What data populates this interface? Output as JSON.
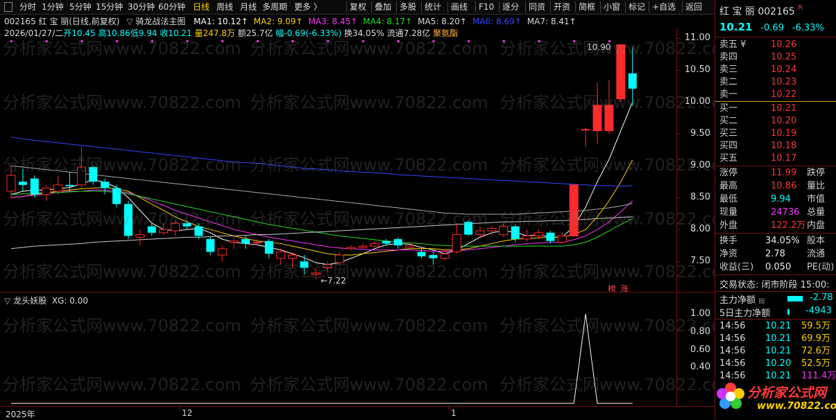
{
  "toolbar": {
    "left_items": [
      "分时",
      "1分钟",
      "5分钟",
      "15分钟",
      "30分钟",
      "60分钟",
      "日线",
      "周线",
      "月线",
      "多周期",
      "更多 〉"
    ],
    "active_item": "日线",
    "right_items": [
      "复权",
      "叠加",
      "多股",
      "统计",
      "画线",
      "F10",
      "逐分",
      "同资",
      "开资",
      "简框",
      "小窗",
      "标记",
      "+自选",
      "返回"
    ]
  },
  "chart_header": {
    "title": "002165 红 宝 丽(日线,前复权)",
    "indicator_name": "骑龙战法主图",
    "ma": [
      {
        "label": "MA1: 10.12↑",
        "color": "#ffffff"
      },
      {
        "label": "MA2: 9.09↑",
        "color": "#ffd200"
      },
      {
        "label": "MA3: 8.45↑",
        "color": "#ff33ff"
      },
      {
        "label": "MA4: 8.17↑",
        "color": "#22dd22"
      },
      {
        "label": "MA5: 8.20↑",
        "color": "#dddddd"
      },
      {
        "label": "MA6: 8.69↑",
        "color": "#3344ff"
      },
      {
        "label": "MA7: 8.41↑",
        "color": "#dddddd"
      }
    ],
    "info_line": {
      "date": "2026/01/27/二",
      "open": "开10.45",
      "high": "高10.86",
      "low": "低9.94",
      "close": "收10.21",
      "volume": "量247.8万",
      "amount": "额25.7亿",
      "change": "幅-0.69(-6.33%)",
      "turnover": "换34.05%",
      "float": "流通7.28亿",
      "concept": "聚氨酯"
    }
  },
  "main_axis": {
    "labels": [
      "11.00",
      "10.50",
      "10.00",
      "9.50",
      "9.00",
      "8.50",
      "8.00",
      "7.50"
    ]
  },
  "annotations": {
    "high": "10.90",
    "low": "←7.22",
    "badge1": "榜",
    "badge2": "涨"
  },
  "sub_chart": {
    "title": "龙头妖股",
    "xg": "XG: 0.00",
    "axis_labels": [
      "1.00",
      "0.80",
      "0.60",
      "0.40"
    ]
  },
  "x_axis": {
    "labels": [
      "2025年",
      "12",
      "1"
    ]
  },
  "watermark": "分析家公式网www.70822.com",
  "colors": {
    "up": "#ff2a2a",
    "down": "#00ffff",
    "bg": "#000000",
    "grid_red": "#7a1010"
  },
  "chart_data": {
    "type": "candlestick",
    "ylim": [
      7.1,
      11.1
    ],
    "candles": [
      {
        "o": 8.6,
        "c": 8.85,
        "h": 9.0,
        "l": 8.5
      },
      {
        "o": 8.75,
        "c": 8.7,
        "h": 8.95,
        "l": 8.6
      },
      {
        "o": 8.8,
        "c": 8.55,
        "h": 8.85,
        "l": 8.5
      },
      {
        "o": 8.55,
        "c": 8.65,
        "h": 8.7,
        "l": 8.45
      },
      {
        "o": 8.6,
        "c": 8.7,
        "h": 8.85,
        "l": 8.55
      },
      {
        "o": 8.7,
        "c": 8.68,
        "h": 8.9,
        "l": 8.6
      },
      {
        "o": 8.7,
        "c": 8.98,
        "h": 9.3,
        "l": 8.65
      },
      {
        "o": 8.98,
        "c": 8.75,
        "h": 9.0,
        "l": 8.7
      },
      {
        "o": 8.75,
        "c": 8.65,
        "h": 8.8,
        "l": 8.55
      },
      {
        "o": 8.65,
        "c": 8.4,
        "h": 8.7,
        "l": 8.35
      },
      {
        "o": 8.4,
        "c": 7.9,
        "h": 8.45,
        "l": 7.85
      },
      {
        "o": 7.88,
        "c": 7.92,
        "h": 8.0,
        "l": 7.75
      },
      {
        "o": 8.05,
        "c": 7.95,
        "h": 8.1,
        "l": 7.9
      },
      {
        "o": 7.95,
        "c": 8.0,
        "h": 8.1,
        "l": 7.92
      },
      {
        "o": 7.98,
        "c": 8.1,
        "h": 8.15,
        "l": 7.9
      },
      {
        "o": 8.1,
        "c": 8.05,
        "h": 8.15,
        "l": 8.0
      },
      {
        "o": 8.05,
        "c": 7.9,
        "h": 8.1,
        "l": 7.85
      },
      {
        "o": 7.85,
        "c": 7.65,
        "h": 7.9,
        "l": 7.6
      },
      {
        "o": 7.6,
        "c": 7.7,
        "h": 7.75,
        "l": 7.5
      },
      {
        "o": 7.8,
        "c": 7.82,
        "h": 7.9,
        "l": 7.7
      },
      {
        "o": 7.85,
        "c": 7.78,
        "h": 7.9,
        "l": 7.7
      },
      {
        "o": 7.8,
        "c": 7.8,
        "h": 7.85,
        "l": 7.75
      },
      {
        "o": 7.82,
        "c": 7.62,
        "h": 7.85,
        "l": 7.55
      },
      {
        "o": 7.55,
        "c": 7.65,
        "h": 7.7,
        "l": 7.45
      },
      {
        "o": 7.55,
        "c": 7.6,
        "h": 7.65,
        "l": 7.4
      },
      {
        "o": 7.5,
        "c": 7.4,
        "h": 7.6,
        "l": 7.3
      },
      {
        "o": 7.3,
        "c": 7.32,
        "h": 7.4,
        "l": 7.22
      },
      {
        "o": 7.4,
        "c": 7.45,
        "h": 7.5,
        "l": 7.35
      },
      {
        "o": 7.48,
        "c": 7.6,
        "h": 7.65,
        "l": 7.45
      },
      {
        "o": 7.7,
        "c": 7.72,
        "h": 7.75,
        "l": 7.68
      },
      {
        "o": 7.72,
        "c": 7.74,
        "h": 7.78,
        "l": 7.7
      },
      {
        "o": 7.74,
        "c": 7.78,
        "h": 7.82,
        "l": 7.72
      },
      {
        "o": 7.82,
        "c": 7.78,
        "h": 7.85,
        "l": 7.75
      },
      {
        "o": 7.85,
        "c": 7.75,
        "h": 7.88,
        "l": 7.7
      },
      {
        "o": 7.72,
        "c": 7.75,
        "h": 7.8,
        "l": 7.68
      },
      {
        "o": 7.65,
        "c": 7.58,
        "h": 7.7,
        "l": 7.55
      },
      {
        "o": 7.6,
        "c": 7.55,
        "h": 7.65,
        "l": 7.45
      },
      {
        "o": 7.55,
        "c": 7.62,
        "h": 7.7,
        "l": 7.52
      },
      {
        "o": 7.65,
        "c": 7.92,
        "h": 8.1,
        "l": 7.62
      },
      {
        "o": 8.12,
        "c": 7.92,
        "h": 8.15,
        "l": 7.9
      },
      {
        "o": 7.92,
        "c": 7.98,
        "h": 8.05,
        "l": 7.88
      },
      {
        "o": 7.98,
        "c": 8.02,
        "h": 8.05,
        "l": 7.9
      },
      {
        "o": 7.92,
        "c": 8.05,
        "h": 8.1,
        "l": 7.88
      },
      {
        "o": 8.05,
        "c": 7.85,
        "h": 8.08,
        "l": 7.8
      },
      {
        "o": 7.85,
        "c": 7.9,
        "h": 8.0,
        "l": 7.82
      },
      {
        "o": 7.9,
        "c": 7.95,
        "h": 8.0,
        "l": 7.85
      },
      {
        "o": 7.95,
        "c": 7.82,
        "h": 7.98,
        "l": 7.78
      },
      {
        "o": 7.8,
        "c": 7.9,
        "h": 7.95,
        "l": 7.78
      },
      {
        "o": 7.9,
        "c": 8.7,
        "h": 8.7,
        "l": 7.88
      },
      {
        "o": 9.57,
        "c": 9.57,
        "h": 9.6,
        "l": 9.3
      },
      {
        "o": 9.55,
        "c": 9.95,
        "h": 10.3,
        "l": 9.35
      },
      {
        "o": 9.55,
        "c": 9.95,
        "h": 10.35,
        "l": 9.5
      },
      {
        "o": 10.05,
        "c": 10.9,
        "h": 10.9,
        "l": 10.0
      },
      {
        "o": 10.45,
        "c": 10.21,
        "h": 10.86,
        "l": 9.94
      }
    ],
    "ma_lines": [
      {
        "name": "MA1",
        "color": "#ffffff",
        "values": [
          8.55,
          8.6,
          8.62,
          8.62,
          8.64,
          8.66,
          8.72,
          8.78,
          8.74,
          8.66,
          8.5,
          8.3,
          8.1,
          8.0,
          7.98,
          8.0,
          8.02,
          7.95,
          7.85,
          7.8,
          7.78,
          7.76,
          7.72,
          7.68,
          7.62,
          7.56,
          7.48,
          7.45,
          7.48,
          7.55,
          7.62,
          7.7,
          7.76,
          7.78,
          7.77,
          7.72,
          7.68,
          7.62,
          7.68,
          7.78,
          7.88,
          7.95,
          7.98,
          7.96,
          7.9,
          7.92,
          7.88,
          7.88,
          8.05,
          8.35,
          8.75,
          9.1,
          9.55,
          10.0
        ]
      },
      {
        "name": "MA2",
        "color": "#ffd200",
        "values": [
          8.5,
          8.52,
          8.55,
          8.58,
          8.6,
          8.62,
          8.64,
          8.65,
          8.66,
          8.64,
          8.6,
          8.5,
          8.4,
          8.3,
          8.2,
          8.12,
          8.05,
          8.0,
          7.95,
          7.9,
          7.86,
          7.82,
          7.8,
          7.78,
          7.74,
          7.7,
          7.66,
          7.62,
          7.6,
          7.6,
          7.62,
          7.64,
          7.66,
          7.68,
          7.7,
          7.7,
          7.7,
          7.68,
          7.68,
          7.7,
          7.74,
          7.78,
          7.82,
          7.85,
          7.86,
          7.87,
          7.88,
          7.88,
          7.92,
          8.0,
          8.2,
          8.45,
          8.75,
          9.09
        ]
      },
      {
        "name": "MA3",
        "color": "#ff33ff",
        "values": [
          8.5,
          8.52,
          8.54,
          8.56,
          8.58,
          8.6,
          8.6,
          8.62,
          8.62,
          8.6,
          8.58,
          8.52,
          8.45,
          8.38,
          8.3,
          8.24,
          8.18,
          8.12,
          8.06,
          8.0,
          7.96,
          7.92,
          7.88,
          7.85,
          7.82,
          7.79,
          7.76,
          7.73,
          7.71,
          7.7,
          7.69,
          7.68,
          7.68,
          7.68,
          7.68,
          7.67,
          7.66,
          7.66,
          7.67,
          7.68,
          7.7,
          7.72,
          7.74,
          7.76,
          7.78,
          7.79,
          7.8,
          7.8,
          7.84,
          7.9,
          8.0,
          8.12,
          8.28,
          8.45
        ]
      },
      {
        "name": "MA4",
        "color": "#22dd22",
        "values": [
          8.55,
          8.56,
          8.57,
          8.58,
          8.58,
          8.59,
          8.6,
          8.6,
          8.6,
          8.58,
          8.56,
          8.52,
          8.48,
          8.44,
          8.4,
          8.36,
          8.32,
          8.28,
          8.24,
          8.2,
          8.16,
          8.12,
          8.08,
          8.05,
          8.02,
          7.99,
          7.96,
          7.93,
          7.9,
          7.88,
          7.86,
          7.84,
          7.82,
          7.8,
          7.79,
          7.78,
          7.76,
          7.75,
          7.74,
          7.74,
          7.74,
          7.74,
          7.74,
          7.74,
          7.74,
          7.74,
          7.74,
          7.74,
          7.76,
          7.8,
          7.88,
          7.98,
          8.08,
          8.17
        ]
      },
      {
        "name": "MA5",
        "color": "#cccccc",
        "values": [
          7.7,
          7.72,
          7.74,
          7.75,
          7.76,
          7.77,
          7.78,
          7.8,
          7.81,
          7.82,
          7.83,
          7.84,
          7.85,
          7.86,
          7.87,
          7.88,
          7.88,
          7.89,
          7.9,
          7.9,
          7.91,
          7.92,
          7.92,
          7.93,
          7.94,
          7.95,
          7.96,
          7.97,
          7.98,
          7.99,
          8.0,
          8.01,
          8.02,
          8.03,
          8.04,
          8.05,
          8.06,
          8.07,
          8.08,
          8.09,
          8.1,
          8.11,
          8.12,
          8.12,
          8.13,
          8.13,
          8.14,
          8.14,
          8.15,
          8.16,
          8.17,
          8.18,
          8.19,
          8.2
        ]
      },
      {
        "name": "MA6",
        "color": "#3344ff",
        "values": [
          9.45,
          9.42,
          9.4,
          9.38,
          9.36,
          9.34,
          9.32,
          9.3,
          9.28,
          9.26,
          9.24,
          9.22,
          9.2,
          9.18,
          9.16,
          9.14,
          9.12,
          9.1,
          9.08,
          9.06,
          9.05,
          9.04,
          9.02,
          9.0,
          8.98,
          8.96,
          8.95,
          8.94,
          8.92,
          8.91,
          8.9,
          8.89,
          8.88,
          8.86,
          8.85,
          8.84,
          8.83,
          8.82,
          8.81,
          8.8,
          8.79,
          8.78,
          8.77,
          8.76,
          8.75,
          8.74,
          8.73,
          8.72,
          8.71,
          8.7,
          8.69,
          8.69,
          8.68,
          8.69
        ]
      },
      {
        "name": "MA7",
        "color": "#aaaaaa",
        "values": [
          9.0,
          8.98,
          8.96,
          8.94,
          8.92,
          8.9,
          8.88,
          8.86,
          8.84,
          8.82,
          8.8,
          8.78,
          8.76,
          8.74,
          8.72,
          8.7,
          8.68,
          8.66,
          8.64,
          8.62,
          8.6,
          8.58,
          8.56,
          8.54,
          8.52,
          8.5,
          8.48,
          8.46,
          8.44,
          8.42,
          8.4,
          8.38,
          8.36,
          8.34,
          8.32,
          8.3,
          8.28,
          8.26,
          8.25,
          8.24,
          8.24,
          8.24,
          8.24,
          8.24,
          8.25,
          8.26,
          8.27,
          8.28,
          8.29,
          8.3,
          8.32,
          8.34,
          8.37,
          8.41
        ]
      }
    ],
    "signal": {
      "ylim": [
        0,
        1.1
      ],
      "values": [
        0,
        0,
        0,
        0,
        0,
        0,
        0,
        0,
        0,
        0,
        0,
        0,
        0,
        0,
        0,
        0,
        0,
        0,
        0,
        0,
        0,
        0,
        0,
        0,
        0,
        0,
        0,
        0,
        0,
        0,
        0,
        0,
        0,
        0,
        0,
        0,
        0,
        0,
        0,
        0,
        0,
        0,
        0,
        0,
        0,
        0,
        0,
        0,
        0,
        1,
        0,
        0,
        0,
        0
      ]
    }
  },
  "panel": {
    "name": "红 宝 丽",
    "code": "002165",
    "r_badge": "R",
    "price": "10.21",
    "change": "-0.69",
    "change_pct": "-6.33%",
    "asks": [
      {
        "label": "卖五 ¥",
        "price": "10.26"
      },
      {
        "label": "卖四",
        "price": "10.25"
      },
      {
        "label": "卖三",
        "price": "10.24"
      },
      {
        "label": "卖二",
        "price": "10.23"
      },
      {
        "label": "卖一",
        "price": "10.22"
      }
    ],
    "bids": [
      {
        "label": "买一",
        "price": "10.21"
      },
      {
        "label": "买二",
        "price": "10.20"
      },
      {
        "label": "买三",
        "price": "10.19"
      },
      {
        "label": "买四",
        "price": "10.18"
      },
      {
        "label": "买五",
        "price": "10.17"
      }
    ],
    "stats": [
      {
        "label": "涨停",
        "value": "11.99",
        "label2": "跌停",
        "cls": "red"
      },
      {
        "label": "最高",
        "value": "10.86",
        "label2": "量比",
        "cls": "red"
      },
      {
        "label": "最低",
        "value": "9.94",
        "label2": "市值",
        "cls": "cyan"
      },
      {
        "label": "现量",
        "value": "24736",
        "label2": "总量",
        "cls": "magenta"
      },
      {
        "label": "外盘",
        "value": "122.2万",
        "label2": "内盘",
        "cls": "red"
      }
    ],
    "stats2": [
      {
        "label": "换手",
        "value": "34.05%",
        "label2": "股本"
      },
      {
        "label": "净资",
        "value": "2.78",
        "label2": "流通"
      },
      {
        "label": "收益(三)",
        "value": "0.050",
        "label2": "PE(动)"
      }
    ],
    "trade_status": "交易状态: 闭市阶段 15:00:",
    "main_flow_label": "主力净额",
    "main_flow_value": "-2.78",
    "flow5_label": "5日主力净额",
    "flow5_value": "-4943",
    "ticks": [
      {
        "time": "14:56",
        "price": "10.21",
        "amt": "59.5万"
      },
      {
        "time": "14:56",
        "price": "10.21",
        "amt": "69.9万"
      },
      {
        "time": "14:56",
        "price": "10.21",
        "amt": "72.6万"
      },
      {
        "time": "14:56",
        "price": "10.20",
        "amt": "52.5万"
      },
      {
        "time": "14:56",
        "price": "10.21",
        "amt": "111.4万"
      }
    ],
    "logo_text": "分析家公式网",
    "logo_url": "www.70822.com"
  }
}
